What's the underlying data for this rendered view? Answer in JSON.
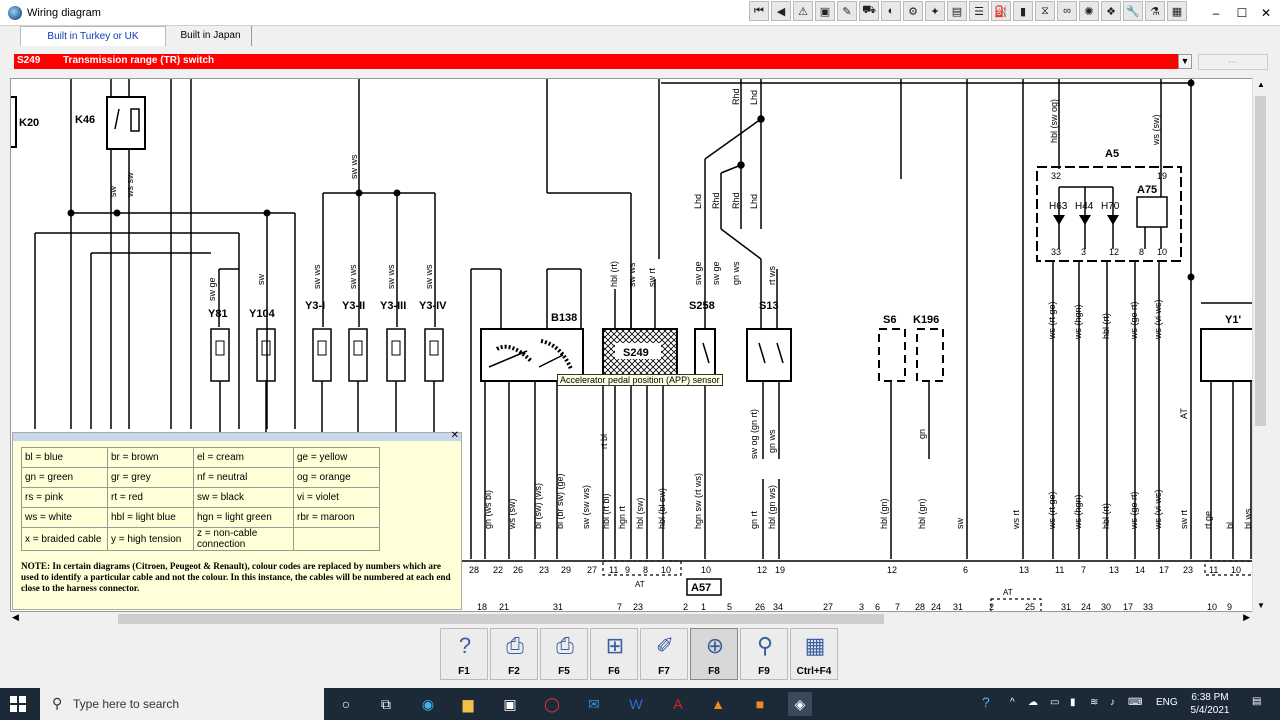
{
  "window": {
    "title": "Wiring diagram"
  },
  "tabs": [
    {
      "label": "Built in Turkey or UK"
    },
    {
      "label": "Built in Japan"
    }
  ],
  "selector": {
    "code": "S249",
    "description": "Transmission range (TR) switch"
  },
  "toolbar_icons": [
    "first-icon",
    "prev-icon",
    "warning-icon",
    "book-icon",
    "tool-icon",
    "car-icon",
    "gauge-icon",
    "engine-icon",
    "spark-icon",
    "clipboard-icon",
    "list-icon",
    "fuel-icon",
    "battery-icon",
    "filter-icon",
    "belt-icon",
    "lamp-icon",
    "airbag-icon",
    "wrench-icon",
    "flask-icon",
    "sheet-icon"
  ],
  "diagram": {
    "components": {
      "k20": "K20",
      "k46": "K46",
      "y81": "Y81",
      "y104": "Y104",
      "y3i": "Y3-I",
      "y3ii": "Y3-II",
      "y3iii": "Y3-III",
      "y3iv": "Y3-IV",
      "b138": "B138",
      "s249": "S249",
      "s258": "S258",
      "s13": "S13",
      "s6": "S6",
      "k196": "K196",
      "a5": "A5",
      "a75": "A75",
      "h63": "H63",
      "h44": "H44",
      "h70": "H70",
      "y1x": "Y1'",
      "a57": "A57"
    },
    "top_labels": {
      "sw1": "sw",
      "ws_sw": "ws sw",
      "sw_ws_top": "sw ws",
      "rhd1": "Rhd",
      "lhd1": "Lhd",
      "hbl_sw_og": "hbl (sw og)",
      "ws_sw_top": "ws (sw)"
    },
    "mid_labels": {
      "sw_ge_y81": "sw ge",
      "sw_y104": "sw",
      "sw_ws_1": "sw ws",
      "sw_ws_2": "sw ws",
      "sw_ws_3": "sw ws",
      "sw_ws_4": "sw ws",
      "hbl_rt": "hbl (rt)",
      "sw_ws_s249": "sw ws",
      "sw_rt": "sw rt",
      "lhd2": "Lhd",
      "rhd2": "Rhd",
      "rhd3": "Rhd",
      "lhd3": "Lhd",
      "sw_ge": "sw ge",
      "sw_ge2": "sw ge",
      "gn_ws": "gn ws",
      "rt_ws": "rt ws"
    },
    "a5_pins_top": [
      "32",
      "19"
    ],
    "a5_pins_bottom": [
      "33",
      "3",
      "12",
      "8",
      "10"
    ],
    "tooltip": "Accelerator pedal position (APP) sensor",
    "lower_labels": [
      "ge",
      "gn (ws bl)",
      "ws (sw)",
      "bl (sw) (ws)",
      "bl (br sw) (ge)",
      "sw (sw ws)",
      "rt bl",
      "hbl (rt bl)",
      "hgn rt",
      "hbl (sw)",
      "hbl (bl sw)",
      "hgn sw (rt ws)",
      "sw og (gn rt)",
      "gn ws",
      "gn rt",
      "hbl (gn ws)",
      "hbl (gn)",
      "gn",
      "hbl (gn)",
      "sw",
      "ws rt",
      "ws (rt ge)",
      "ws (hgn)",
      "hbl (rt)",
      "ws (ge rt)",
      "ws (vi ws)",
      "AT",
      "sw rt",
      "rt ge",
      "bl",
      "bl ws"
    ],
    "a5_lower": [
      "ws (rt ge)",
      "ws (hgn)",
      "hbl (rt)",
      "ws (ge rt)",
      "ws (vi ws)"
    ],
    "bottom_pins": [
      "28",
      "22",
      "26",
      "23",
      "29",
      "27",
      "11",
      "9",
      "8",
      "10",
      "10",
      "12",
      "19",
      "12",
      "6",
      "13",
      "11",
      "7",
      "13",
      "14",
      "17",
      "23",
      "11",
      "10",
      "1"
    ],
    "bottom_row2": [
      "18",
      "21",
      "31",
      "7",
      "23",
      "2",
      "1",
      "5",
      "26",
      "34",
      "27",
      "3",
      "6",
      "7",
      "28",
      "24",
      "31",
      "2",
      "25",
      "31",
      "24",
      "30",
      "17",
      "33",
      "10",
      "9"
    ],
    "at_labels": [
      "AT",
      "AT"
    ]
  },
  "legend": {
    "rows": [
      [
        "bl = blue",
        "br = brown",
        "el = cream",
        "ge = yellow"
      ],
      [
        "gn = green",
        "gr = grey",
        "nf = neutral",
        "og = orange"
      ],
      [
        "rs = pink",
        "rt = red",
        "sw = black",
        "vi = violet"
      ],
      [
        "ws = white",
        "hbl = light blue",
        "hgn = light green",
        "rbr = maroon"
      ],
      [
        "x = braided cable",
        "y = high tension",
        "z = non-cable connection",
        ""
      ]
    ],
    "note": "NOTE: In certain diagrams (Citroen, Peugeot & Renault), colour codes are replaced by numbers which are used to identify a particular cable and not the colour. In this instance, the cables will be numbered at each end close to the harness connector."
  },
  "fkeys": [
    {
      "label": "F1",
      "icon": "help-icon"
    },
    {
      "label": "F2",
      "icon": "printer-setup-icon"
    },
    {
      "label": "F5",
      "icon": "print-icon"
    },
    {
      "label": "F6",
      "icon": "diagram-tree-icon"
    },
    {
      "label": "F7",
      "icon": "pen-icon"
    },
    {
      "label": "F8",
      "icon": "zoom-diagram-icon"
    },
    {
      "label": "F9",
      "icon": "magnifier-icon"
    },
    {
      "label": "Ctrl+F4",
      "icon": "table-icon"
    }
  ],
  "taskbar": {
    "search_placeholder": "Type here to search",
    "lang": "ENG",
    "time": "6:38 PM",
    "date": "5/4/2021"
  }
}
